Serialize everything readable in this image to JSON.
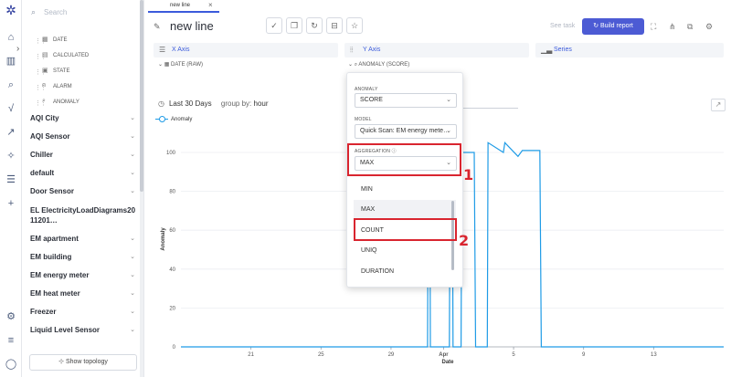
{
  "app": {
    "search_placeholder": "Search",
    "tab_label": "new line",
    "title": "new line",
    "see_task": "See task",
    "build_report": "Build report",
    "show_topology": "Show topology"
  },
  "sidebar": {
    "fields": [
      {
        "name": "DATE",
        "icon": "calendar-icon"
      },
      {
        "name": "CALCULATED",
        "icon": "calc-icon"
      },
      {
        "name": "STATE",
        "icon": "state-icon"
      },
      {
        "name": "ALARM",
        "icon": "alarm-icon"
      },
      {
        "name": "ANOMALY",
        "icon": "anomaly-icon"
      }
    ],
    "groups": [
      "AQI City",
      "AQI Sensor",
      "Chiller",
      "default",
      "Door Sensor",
      "EL ElectricityLoadDiagrams2011201…",
      "EM apartment",
      "EM building",
      "EM energy meter",
      "EM heat meter",
      "Freezer",
      "Liquid Level Sensor"
    ]
  },
  "axes": {
    "x_label": "X Axis",
    "x_value": "DATE (RAW)",
    "y_label": "Y Axis",
    "y_value": "ANOMALY (SCORE)",
    "series_label": "Series"
  },
  "range": {
    "period": "Last 30 Days",
    "group_by_label": "group by:",
    "group_by_value": "hour"
  },
  "dropdown": {
    "anomaly_label": "ANOMALY",
    "anomaly_value": "SCORE",
    "model_label": "MODEL",
    "model_value": "Quick Scan: EM energy mete…",
    "aggregation_label": "AGGREGATION",
    "aggregation_value": "MAX",
    "options": [
      "MIN",
      "MAX",
      "COUNT",
      "UNIQ",
      "DURATION"
    ],
    "highlighted_option": "MAX"
  },
  "annotations": {
    "marker_1": "1",
    "marker_2": "2"
  },
  "colors": {
    "accent": "#4c5bd4",
    "series": "#1e9be6",
    "highlight": "#d9252f"
  },
  "chart_data": {
    "type": "line",
    "title": "",
    "xlabel": "Date",
    "ylabel": "Anomaly",
    "ylim": [
      0,
      100
    ],
    "grid": true,
    "legend": "top-left",
    "x_ticks": [
      "21",
      "25",
      "29",
      "Apr",
      "5",
      "9",
      "13"
    ],
    "y_ticks": [
      "0",
      "20",
      "40",
      "60",
      "80",
      "100"
    ],
    "series": [
      {
        "name": "Anomaly",
        "points": [
          [
            "Mar 17",
            0
          ],
          [
            "Mar 31 02:00",
            0
          ],
          [
            "Mar 31 03:00",
            100
          ],
          [
            "Mar 31 05:00",
            100
          ],
          [
            "Mar 31 06:00",
            0
          ],
          [
            "Apr 1 08:00",
            0
          ],
          [
            "Apr 1 09:00",
            100
          ],
          [
            "Apr 1 12:00",
            100
          ],
          [
            "Apr 1 13:00",
            0
          ],
          [
            "Apr 2 00:00",
            0
          ],
          [
            "Apr 2 01:00",
            100
          ],
          [
            "Apr 2 18:00",
            100
          ],
          [
            "Apr 2 20:00",
            0
          ],
          [
            "Apr 3 12:00",
            0
          ],
          [
            "Apr 3 13:00",
            105
          ],
          [
            "Apr 4 10:00",
            100
          ],
          [
            "Apr 4 12:00",
            105
          ],
          [
            "Apr 5 06:00",
            98
          ],
          [
            "Apr 5 12:00",
            101
          ],
          [
            "Apr 6 12:00",
            101
          ],
          [
            "Apr 6 14:00",
            0
          ],
          [
            "Apr 17",
            0
          ]
        ]
      }
    ]
  }
}
